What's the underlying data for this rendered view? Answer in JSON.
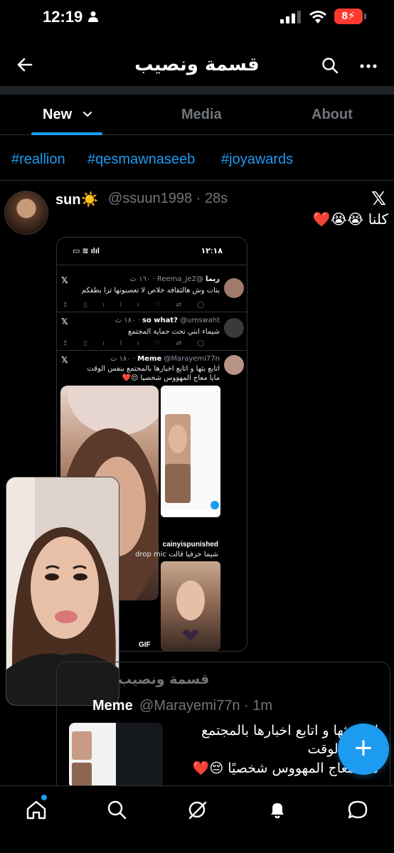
{
  "status_bar": {
    "time": "12:19",
    "battery": "8"
  },
  "header": {
    "title": "قسمة ونصيب"
  },
  "tabs": [
    {
      "label": "New"
    },
    {
      "label": "Media"
    },
    {
      "label": "About"
    }
  ],
  "hashtags": [
    "#reallion",
    "#qesmawnaseeb",
    "#joyawards"
  ],
  "tweet": {
    "name": "sun☀️",
    "handle": "@ssuun1998 · 28s",
    "text": "كلنا 😭😭❤️"
  },
  "embedded": {
    "time": "١٢:١٨",
    "rows": [
      {
        "name": "ريما",
        "meta": "@Reema_je2 · ١٦٠ ث",
        "body": "بنات وش هالثقافه خلاص لا تعصبونها ترا بطفكم"
      },
      {
        "name": "so what?",
        "meta": "@umswaht · ١٨٠ ث",
        "body": "شيماء انتي تحت حماية المجتمع"
      },
      {
        "name": "Meme",
        "meta": "@Marayemi77n · ١٨٠ ث",
        "body1": "اتابع بثها و اتابع اخبارها بالمجتمع بنفس الوقت",
        "body2": "مايا معاج المهووس شخصيا 😔❤️"
      }
    ],
    "row2_name": "cainyispunished",
    "row2_body": "شيما حرفيا قالت drop mic",
    "gif": "GIF"
  },
  "quote": {
    "community": "قسمة ونصيب",
    "name": "Meme",
    "handle": "@Marayemi77n · 1m",
    "line1": "اتابع بثها و اتابع اخبارها بالمجتمع",
    "line2": "بنفس الوقت",
    "line3": "مايا معاج المهووس شخصيًا 😔❤️"
  },
  "colors": {
    "accent": "#1d9bf0",
    "background": "#000000",
    "battery": "#ff3b30"
  },
  "icons": [
    "back-arrow-icon",
    "search-icon",
    "more-icon",
    "chevron-down-icon",
    "x-logo-icon",
    "home-icon",
    "explore-icon",
    "grok-icon",
    "notifications-icon",
    "messages-icon",
    "compose-plus-icon"
  ]
}
